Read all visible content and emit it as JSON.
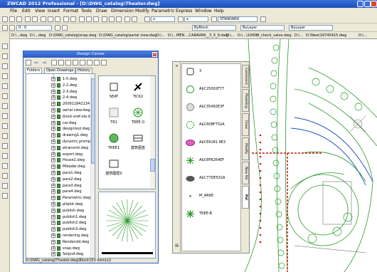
{
  "app": {
    "title": "ZWCAD 2012 Professional - [D:\\DWG_catalog\\Theater.dwg]"
  },
  "menu": [
    "File",
    "Edit",
    "View",
    "Insert",
    "Format",
    "Tools",
    "Draw",
    "Dimension",
    "Modify",
    "Parametric",
    "Express",
    "Window",
    "Help"
  ],
  "toolbar": {
    "text_style": "STANDARD",
    "layer": "0 : 0",
    "color": "ByBlock",
    "linetype": "ByLayer",
    "lineweight": "ByLayer"
  },
  "file_tabs": [
    "D:\\...dwg",
    "D:\\...dwg",
    "D:\\DWG_catalog\\snap.dwg",
    "D:\\DWG_catalog\\aerial view.dwg",
    "D:\\...",
    "D:\\...MEN....CARAVAN__3_X_9.dwg",
    "D:\\...",
    "D:\\...\\100NB_check_valve.dwg",
    "D:\\...",
    "D:\\New\\16740415.dwg",
    "D:\\..."
  ],
  "design_center": {
    "title": "Design Center",
    "tabs": [
      "Folders",
      "Open Drawings",
      "History"
    ],
    "tree_items": [
      "1-5.dwg",
      "2-2.dwg",
      "2-3.dwg",
      "2-4.dwg",
      "200911842134",
      "aerial view.dwg",
      "block-xref-ole.dwg",
      "car.dwg",
      "designtool.dwg",
      "drawing1.dwg",
      "dynamic prompt.dwg",
      "etransmit.dwg",
      "export.dwg",
      "House1.dwg",
      "Mleader.dwg",
      "para1.dwg",
      "para2.dwg",
      "para3.dwg",
      "para4.dwg",
      "Parametric.dwg",
      "pltplot.dwg",
      "publish.dwg",
      "publish1.dwg",
      "publish2.dwg",
      "publish3.dwg",
      "rendering.dwg",
      "Renderold.dwg",
      "snap.dwg",
      "Solprof.dwg"
    ],
    "blocks": [
      "SEAT",
      "TICK2",
      "TR1",
      "TREE O",
      "TREE1",
      "建筑图签",
      "建筑图框0"
    ],
    "status": "D:\\DWG_catalog\\Theater.dwg\\Block\\(53 item(s))"
  },
  "palette": {
    "items": [
      "3",
      "A$C25002F77",
      "A$C35492E3F",
      "A$C60BF752A",
      "A$C69181 9E3",
      "A$C6FB264EF",
      "A$C77DE532A",
      "M_ARKE",
      "TREE-B"
    ],
    "tabs": [
      "Command",
      "Modeling",
      "Draw",
      "Modify",
      "New Pal",
      "Pal"
    ]
  },
  "colors": {
    "accent": "#2a5ac8",
    "cad_green": "#2a9a2a",
    "cad_red": "#d01010"
  }
}
